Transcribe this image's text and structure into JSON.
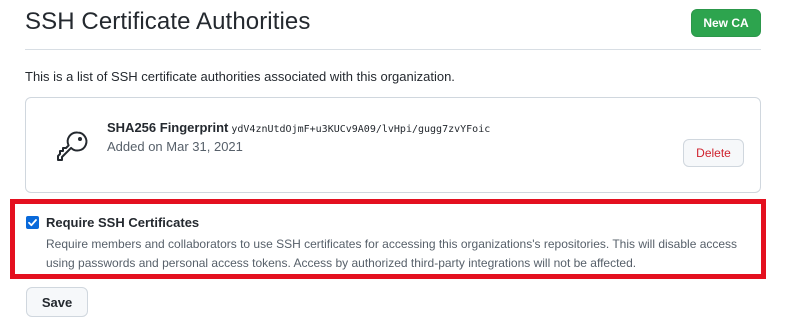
{
  "header": {
    "title": "SSH Certificate Authorities",
    "new_ca_label": "New CA"
  },
  "description": "This is a list of SSH certificate authorities associated with this organization.",
  "certificate_authorities": [
    {
      "icon": "key-icon",
      "fingerprint_label": "SHA256 Fingerprint",
      "fingerprint_value": "ydV4znUtdOjmF+u3KUCv9A09/lvHpi/gugg7zvYFoic",
      "added_text": "Added on Mar 31, 2021",
      "delete_label": "Delete"
    }
  ],
  "require_ssh": {
    "checked": true,
    "label": "Require SSH Certificates",
    "note": "Require members and collaborators to use SSH certificates for accessing this organizations's repositories. This will disable access using passwords and personal access tokens. Access by authorized third-party integrations will not be affected."
  },
  "save_label": "Save",
  "colors": {
    "primary_button": "#2da44e",
    "danger_text": "#cf222e",
    "highlight_border": "#e4101f",
    "checkbox": "#0969da"
  }
}
